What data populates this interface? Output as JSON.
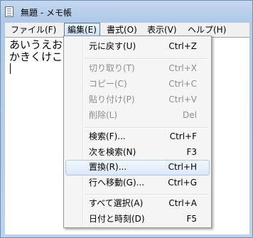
{
  "window": {
    "title": "無題 - メモ帳"
  },
  "menubar": {
    "items": [
      {
        "label": "ファイル(F)"
      },
      {
        "label": "編集(E)",
        "active": true
      },
      {
        "label": "書式(O)"
      },
      {
        "label": "表示(V)"
      },
      {
        "label": "ヘルプ(H)"
      }
    ]
  },
  "editor": {
    "lines": [
      "あいうえお",
      "かきくけこ",
      ""
    ]
  },
  "edit_menu": {
    "items": [
      {
        "label": "元に戻す(U)",
        "shortcut": "Ctrl+Z",
        "enabled": true
      },
      {
        "label": "切り取り(T)",
        "shortcut": "Ctrl+X",
        "enabled": false
      },
      {
        "label": "コピー(C)",
        "shortcut": "Ctrl+C",
        "enabled": false
      },
      {
        "label": "貼り付け(P)",
        "shortcut": "Ctrl+V",
        "enabled": false
      },
      {
        "label": "削除(L)",
        "shortcut": "Del",
        "enabled": false
      },
      {
        "label": "検索(F)...",
        "shortcut": "Ctrl+F",
        "enabled": true
      },
      {
        "label": "次を検索(N)",
        "shortcut": "F3",
        "enabled": true
      },
      {
        "label": "置換(R)...",
        "shortcut": "Ctrl+H",
        "enabled": true,
        "highlighted": true
      },
      {
        "label": "行へ移動(G)...",
        "shortcut": "Ctrl+G",
        "enabled": true
      },
      {
        "label": "すべて選択(A)",
        "shortcut": "Ctrl+A",
        "enabled": true
      },
      {
        "label": "日付と時刻(D)",
        "shortcut": "F5",
        "enabled": true
      }
    ]
  }
}
